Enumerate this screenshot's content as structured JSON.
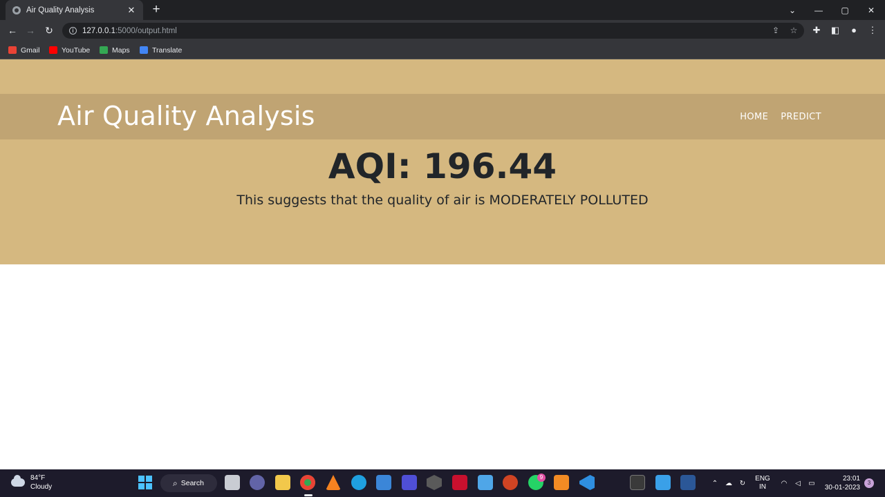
{
  "browser": {
    "tab_title": "Air Quality Analysis",
    "url_host": "127.0.0.1",
    "url_path": ":5000/output.html",
    "bookmarks": [
      {
        "label": "Gmail",
        "color": "#ea4335"
      },
      {
        "label": "YouTube",
        "color": "#ff0000"
      },
      {
        "label": "Maps",
        "color": "#34a853"
      },
      {
        "label": "Translate",
        "color": "#4285f4"
      }
    ]
  },
  "site": {
    "brand": "Air Quality Analysis",
    "nav": {
      "home": "HOME",
      "predict": "PREDICT"
    },
    "result": {
      "aqi_label": "AQI: 196.44",
      "message": "This suggests that the quality of air is MODERATELY POLLUTED"
    },
    "colors": {
      "hero": "#d5b880",
      "navband": "#c0a473",
      "text": "#212529"
    }
  },
  "taskbar": {
    "weather": {
      "temp": "84°F",
      "condition": "Cloudy"
    },
    "search_label": "Search",
    "language": {
      "line1": "ENG",
      "line2": "IN"
    },
    "clock": {
      "time": "23:01",
      "date": "30-01-2023"
    },
    "notification_count": "3",
    "whatsapp_badge": "9"
  }
}
